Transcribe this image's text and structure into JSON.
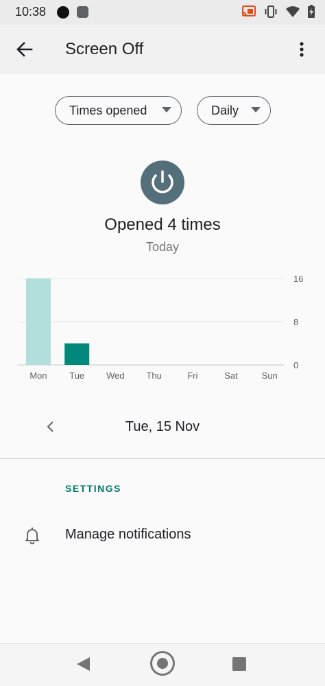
{
  "status_bar": {
    "time": "10:38",
    "icons": [
      "notification-dot-icon",
      "notification-square-icon",
      "cast-icon",
      "vibrate-icon",
      "wifi-icon",
      "battery-icon"
    ],
    "cast_color": "#e64a19"
  },
  "toolbar": {
    "title": "Screen Off",
    "back_icon": "arrow-back-icon",
    "more_icon": "more-vert-icon"
  },
  "filters": {
    "metric": "Times opened",
    "period": "Daily"
  },
  "summary": {
    "icon": "power-icon",
    "icon_color": "#546e7a",
    "headline": "Opened 4 times",
    "subline": "Today"
  },
  "chart_data": {
    "type": "bar",
    "categories": [
      "Mon",
      "Tue",
      "Wed",
      "Thu",
      "Fri",
      "Sat",
      "Sun"
    ],
    "values": [
      16,
      4,
      0,
      0,
      0,
      0,
      0
    ],
    "selected_index": 1,
    "y_ticks": [
      "16",
      "8",
      "0"
    ],
    "ylim": [
      0,
      16
    ],
    "grid": true,
    "axis_side": "right",
    "colors": {
      "default": "#b2dfdb",
      "selected": "#00897b"
    }
  },
  "date_nav": {
    "prev_icon": "chevron-left-icon",
    "date": "Tue, 15 Nov"
  },
  "settings": {
    "header": "SETTINGS",
    "items": [
      {
        "icon": "bell-icon",
        "label": "Manage notifications"
      }
    ]
  },
  "colors": {
    "accent": "#00796b"
  }
}
